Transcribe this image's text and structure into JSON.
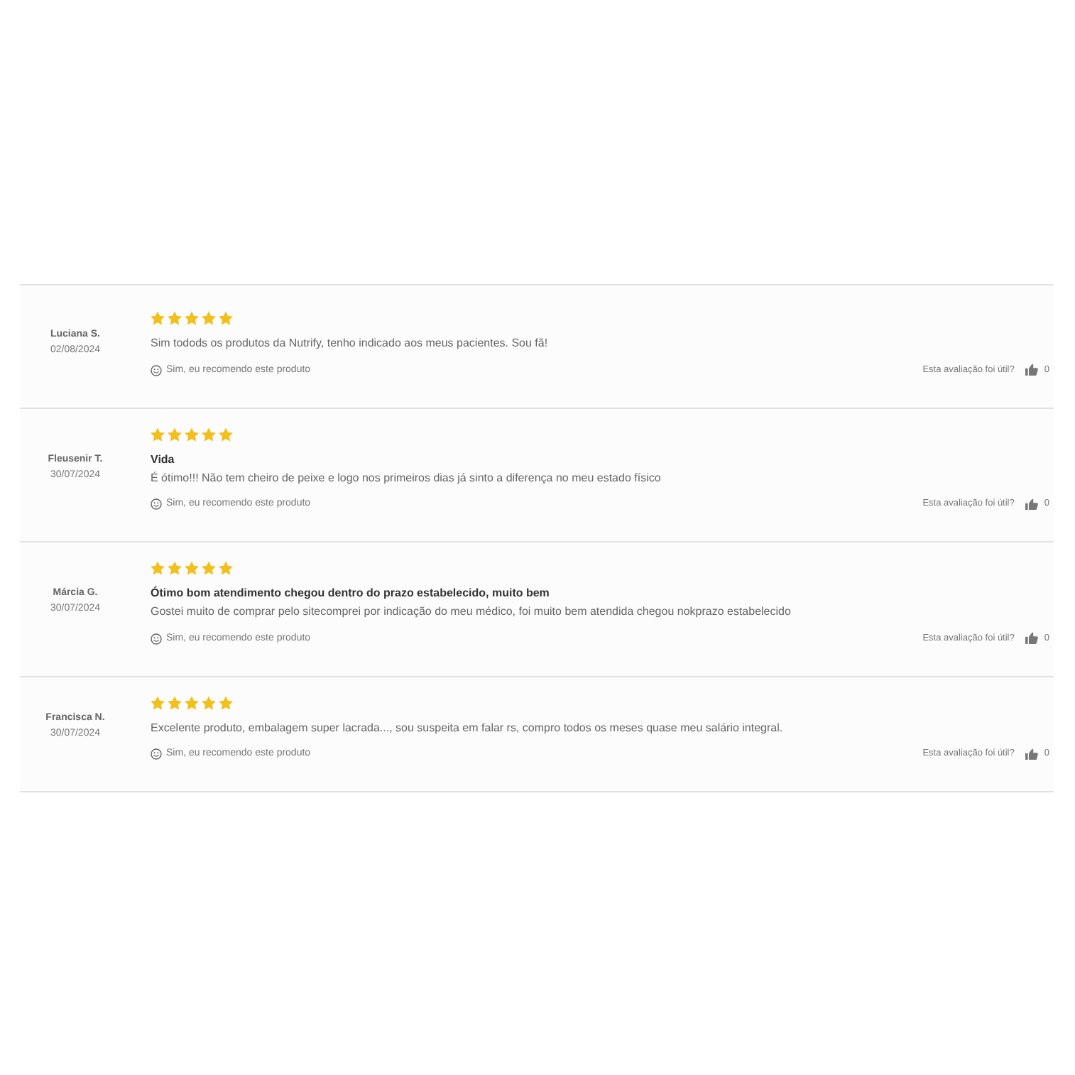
{
  "reviews": [
    {
      "author": "Luciana S.",
      "date": "02/08/2024",
      "stars": 5,
      "text": "Sim todods os produtos da Nutrify, tenho indicado aos meus pacientes. Sou fã!",
      "recommend": "Sim, eu recomendo este produto",
      "helpful_prompt": "Esta avaliação foi útil?",
      "helpful_count": "0"
    },
    {
      "author": "Fleusenir T.",
      "date": "30/07/2024",
      "stars": 5,
      "title": "Vida",
      "text": "É ótimo!!! Não tem cheiro de peixe e logo nos primeiros dias já sinto a diferença no meu estado físico",
      "recommend": "Sim, eu recomendo este produto",
      "helpful_prompt": "Esta avaliação foi útil?",
      "helpful_count": "0"
    },
    {
      "author": "Márcia G.",
      "date": "30/07/2024",
      "stars": 5,
      "title": "Ótimo bom atendimento chegou dentro do prazo estabelecido, muito bem",
      "text": "Gostei muito de comprar pelo sitecomprei por indicação do meu médico, foi muito bem atendida chegou nokprazo estabelecido",
      "recommend": "Sim, eu recomendo este produto",
      "helpful_prompt": "Esta avaliação foi útil?",
      "helpful_count": "0"
    },
    {
      "author": "Francisca N.",
      "date": "30/07/2024",
      "stars": 5,
      "text": "Excelente produto, embalagem super lacrada..., sou suspeita em falar rs, compro todos os meses quase meu salário integral.",
      "recommend": "Sim, eu recomendo este produto",
      "helpful_prompt": "Esta avaliação foi útil?",
      "helpful_count": "0"
    }
  ]
}
